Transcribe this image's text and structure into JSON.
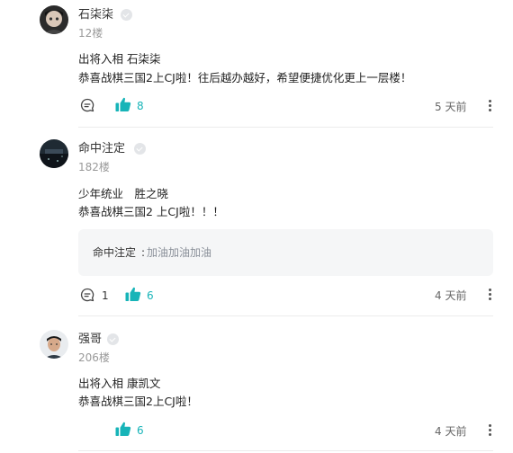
{
  "colors": {
    "accent": "#17b4b8",
    "muted": "#999999"
  },
  "comments": [
    {
      "username": "石柒柒",
      "floor": "12楼",
      "lines": [
        "出将入相 石柒柒",
        "恭喜战棋三国2上CJ啦！往后越办越好，希望便捷优化更上一层楼！"
      ],
      "reply_count": "",
      "like_count": "8",
      "time": "5 天前"
    },
    {
      "username": "命中注定",
      "floor": "182楼",
      "lines": [
        "少年统业　胜之晓",
        "恭喜战棋三国2 上CJ啦！！！"
      ],
      "quote": {
        "user": "命中注定",
        "sep": ": ",
        "text": "加油加油加油"
      },
      "reply_count": "1",
      "like_count": "6",
      "time": "4 天前"
    },
    {
      "username": "强哥",
      "floor": "206楼",
      "lines": [
        "出将入相 康凯文",
        "恭喜战棋三国2上CJ啦！"
      ],
      "reply_count": "",
      "like_count": "6",
      "time": "4 天前"
    }
  ]
}
